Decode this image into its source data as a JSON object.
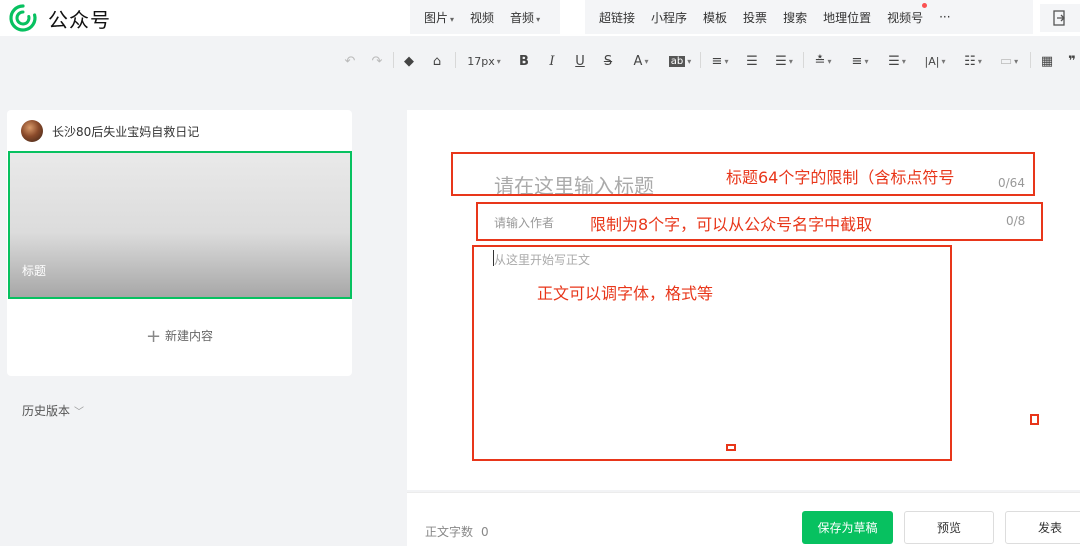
{
  "app": {
    "brand": "公众号"
  },
  "topbar": {
    "group1": [
      {
        "label": "图片",
        "caret": true
      },
      {
        "label": "视频",
        "caret": false
      },
      {
        "label": "音频",
        "caret": true
      }
    ],
    "group2": [
      {
        "label": "超链接"
      },
      {
        "label": "小程序"
      },
      {
        "label": "模板"
      },
      {
        "label": "投票"
      },
      {
        "label": "搜索"
      },
      {
        "label": "地理位置"
      },
      {
        "label": "视频号",
        "dot": true
      },
      {
        "label": "···"
      }
    ]
  },
  "format": {
    "font_size": "17px",
    "bold": "B",
    "italic": "I",
    "underline": "U",
    "strike": "S",
    "font_color": "A",
    "bg_color": "ab",
    "letter_spacing": "|A|"
  },
  "sidebar": {
    "account_name": "长沙80后失业宝妈自救日记",
    "card_title": "标题",
    "new_content": "新建内容",
    "history": "历史版本"
  },
  "editor": {
    "title_placeholder": "请在这里输入标题",
    "title_count": "0/64",
    "author_placeholder": "请输入作者",
    "author_count": "0/8",
    "body_placeholder": "从这里开始写正文"
  },
  "footer": {
    "word_count_label": "正文字数",
    "word_count": "0",
    "save_draft": "保存为草稿",
    "preview": "预览",
    "publish": "发表"
  },
  "annotations": {
    "title_note": "标题64个字的限制（含标点符号",
    "author_note": "限制为8个字，可以从公众号名字中截取",
    "body_note": "正文可以调字体，格式等"
  },
  "colors": {
    "accent": "#07c160",
    "annotation": "#e8361a"
  }
}
